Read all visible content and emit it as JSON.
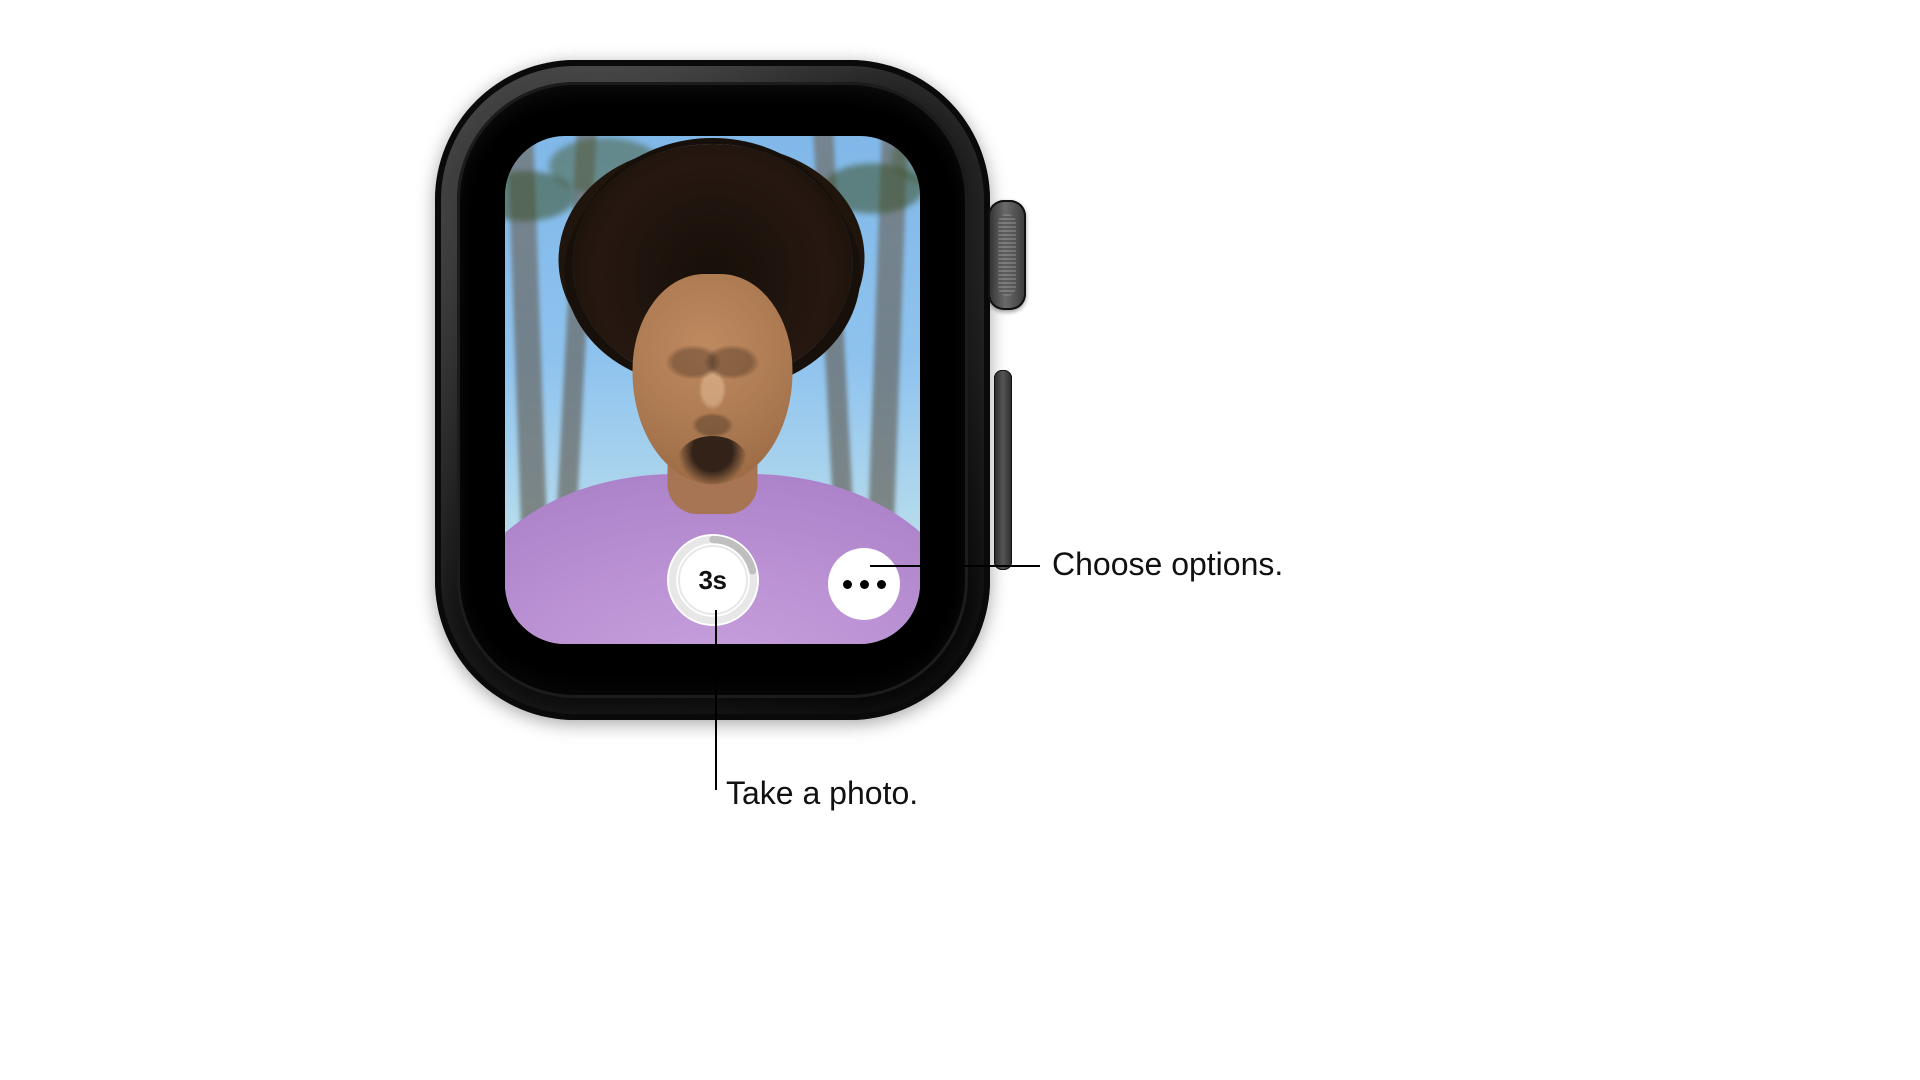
{
  "device": {
    "type": "smartwatch",
    "hardware": {
      "crown": "digital-crown",
      "side_button": "side-button"
    }
  },
  "camera_remote": {
    "shutter_timer_label": "3s",
    "options_button_label": "More options"
  },
  "callouts": {
    "take_photo": "Take a photo.",
    "choose_options": "Choose options."
  }
}
